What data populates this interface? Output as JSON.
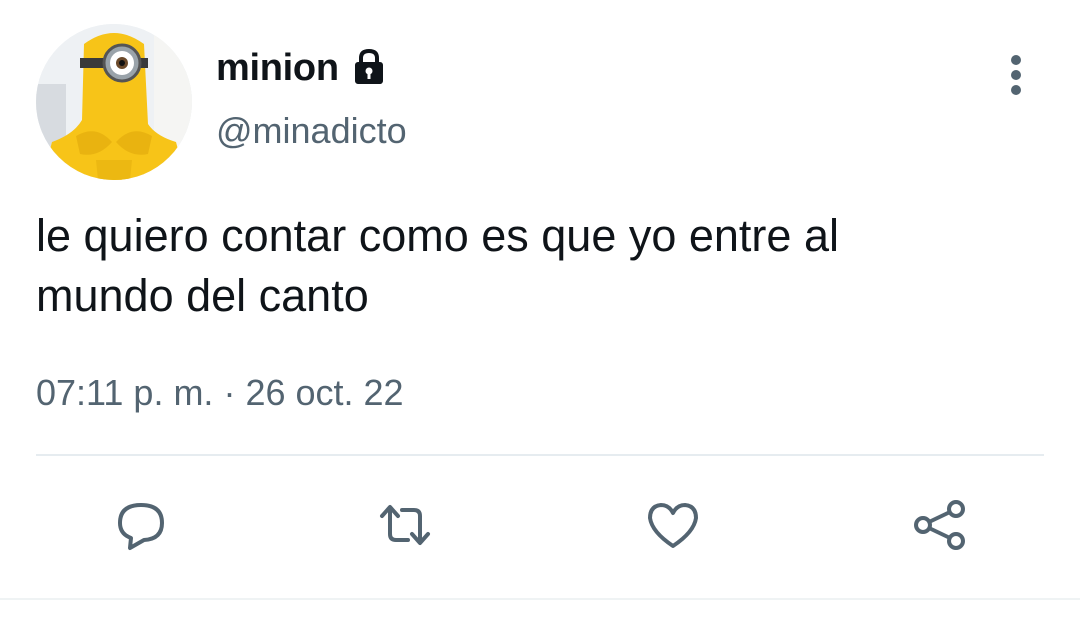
{
  "user": {
    "display_name": "minion",
    "handle": "@minadicto",
    "protected_icon": "lock-icon",
    "avatar_icon": "minion-avatar"
  },
  "tweet": {
    "text": "le quiero contar como es que yo entre al\nmundo del canto",
    "time": "07:11 p. m.",
    "separator": " · ",
    "date": "26 oct. 22"
  },
  "actions": {
    "reply_icon": "reply-icon",
    "retweet_icon": "retweet-icon",
    "like_icon": "heart-icon",
    "share_icon": "share-icon",
    "more_icon": "more-vertical-icon"
  },
  "colors": {
    "text_primary": "#0f1419",
    "text_secondary": "#536471",
    "divider": "#e6ecf0",
    "avatar_yellow": "#f7c418"
  }
}
